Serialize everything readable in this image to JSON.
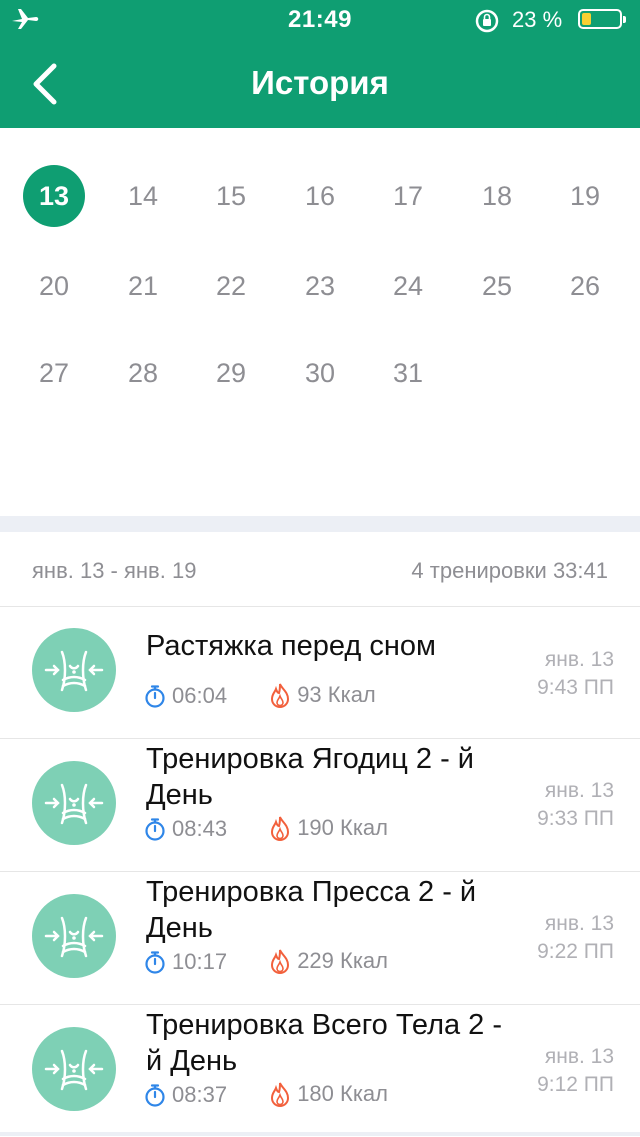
{
  "status_bar": {
    "time": "21:49",
    "battery_percent": "23 %"
  },
  "header": {
    "title": "История"
  },
  "calendar": {
    "selected_day": "13",
    "weeks": [
      [
        "13",
        "14",
        "15",
        "16",
        "17",
        "18",
        "19"
      ],
      [
        "20",
        "21",
        "22",
        "23",
        "24",
        "25",
        "26"
      ],
      [
        "27",
        "28",
        "29",
        "30",
        "31"
      ]
    ]
  },
  "summary": {
    "range": "янв. 13 - янв. 19",
    "totals": "4 тренировки 33:41"
  },
  "workouts": [
    {
      "name": "Растяжка перед сном",
      "duration": "06:04",
      "calories": "93 Ккал",
      "date": "янв. 13",
      "time": "9:43 ПП"
    },
    {
      "name": "Тренировка Ягодиц 2 - й День",
      "duration": "08:43",
      "calories": "190 Ккал",
      "date": "янв. 13",
      "time": "9:33 ПП"
    },
    {
      "name": "Тренировка Пресса 2 - й День",
      "duration": "10:17",
      "calories": "229 Ккал",
      "date": "янв. 13",
      "time": "9:22 ПП"
    },
    {
      "name": "Тренировка Всего Тела  2 - й День",
      "duration": "08:37",
      "calories": "180 Ккал",
      "date": "янв. 13",
      "time": "9:12 ПП"
    }
  ],
  "colors": {
    "accent": "#0f9e72",
    "avatar": "#7ed0b5",
    "timer_icon": "#2f86e8",
    "flame_icon": "#f2603c"
  },
  "icons": [
    "airplane-icon",
    "rotation-lock-icon",
    "battery-icon",
    "back-chevron-icon",
    "timer-icon",
    "flame-icon",
    "waist-icon"
  ]
}
